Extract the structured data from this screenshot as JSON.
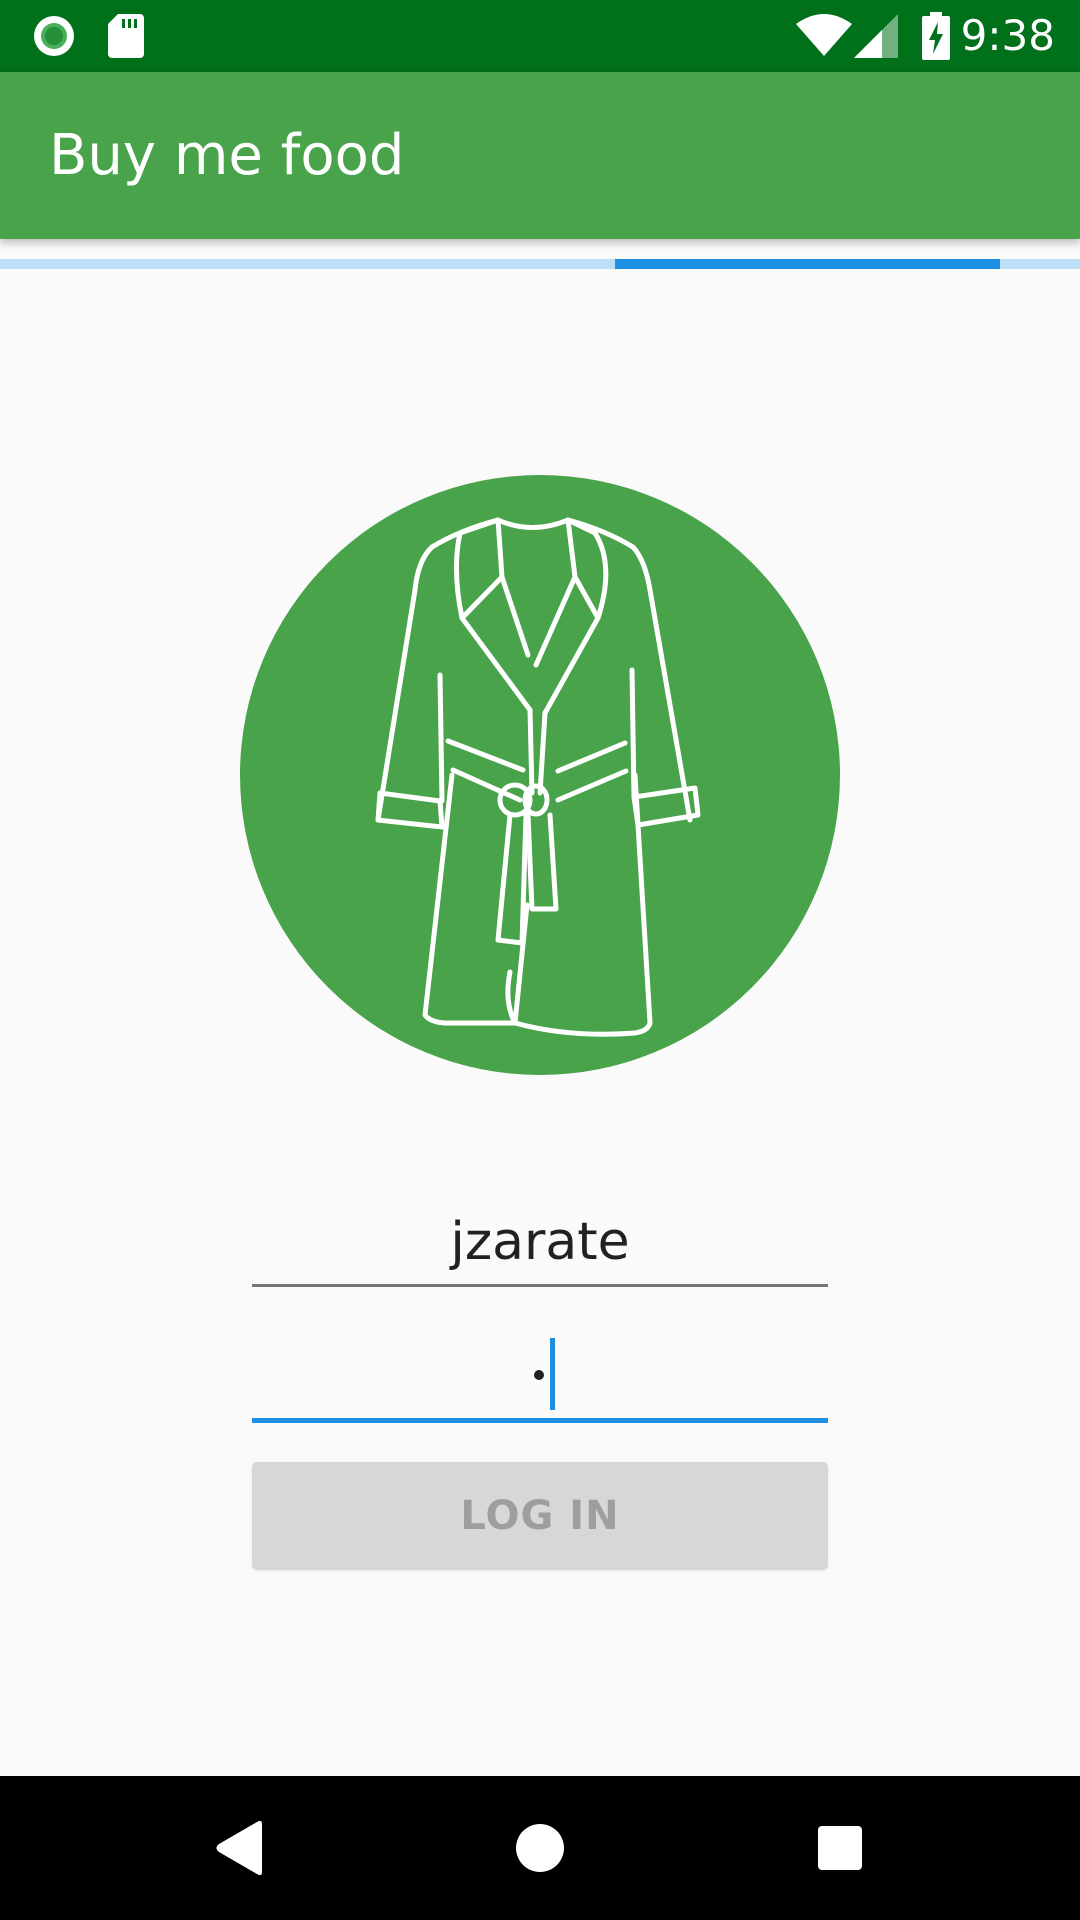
{
  "status_bar": {
    "time": "9:38",
    "icons": [
      "record-icon",
      "sd-card-icon",
      "wifi-icon",
      "signal-icon",
      "battery-charging-icon"
    ]
  },
  "app_bar": {
    "title": "Buy me food"
  },
  "progress": {
    "indicator_color": "#1e8ee0",
    "track_color": "#bcdff8"
  },
  "avatar": {
    "icon": "bathrobe-icon",
    "background": "#48a34a"
  },
  "login_form": {
    "username_value": "jzarate",
    "password_value": "•",
    "login_label": "LOG IN"
  },
  "nav_bar": {
    "buttons": [
      "back-icon",
      "home-icon",
      "recents-icon"
    ]
  },
  "colors": {
    "status_bar": "#00701a",
    "primary": "#48a34a",
    "accent": "#1e8ee0",
    "button_disabled": "#d6d7d7"
  }
}
